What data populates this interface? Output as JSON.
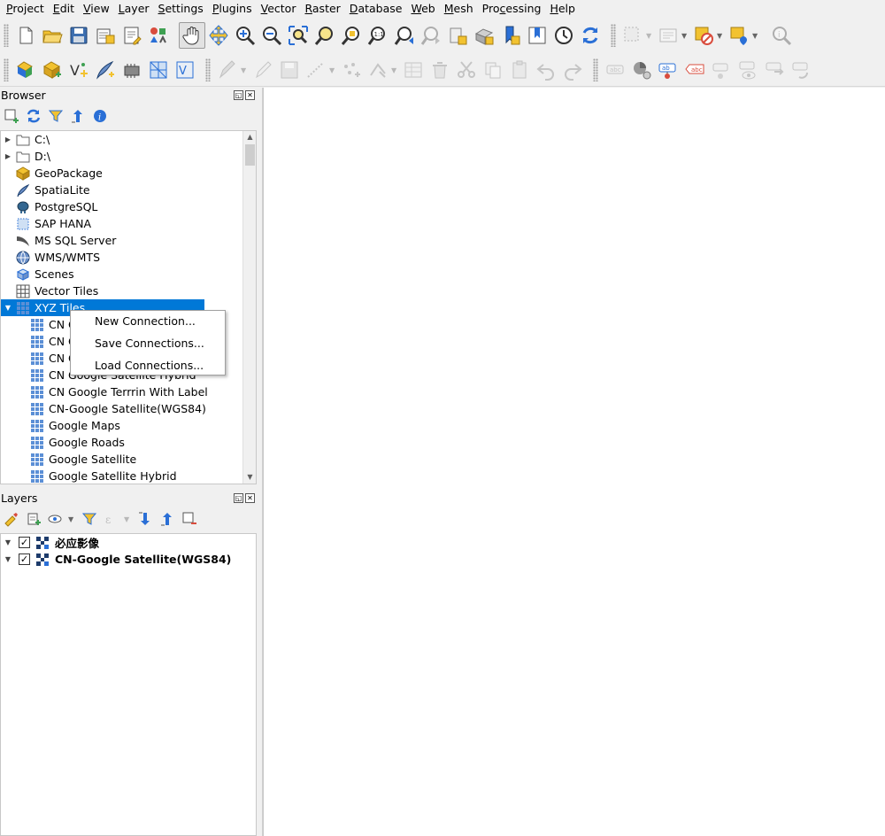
{
  "menubar": {
    "items": [
      {
        "acc": "P",
        "rest": "roject"
      },
      {
        "acc": "E",
        "rest": "dit"
      },
      {
        "acc": "V",
        "rest": "iew"
      },
      {
        "acc": "L",
        "rest": "ayer"
      },
      {
        "acc": "S",
        "rest": "ettings"
      },
      {
        "acc": "P",
        "rest": "lugins"
      },
      {
        "acc": "V",
        "rest": "ector"
      },
      {
        "acc": "R",
        "rest": "aster"
      },
      {
        "acc": "D",
        "rest": "atabase"
      },
      {
        "acc": "W",
        "rest": "eb"
      },
      {
        "acc": "M",
        "rest": "esh"
      },
      {
        "acc": "",
        "rest": "Processing",
        "pre": "Pro",
        "accmid": "c",
        "post": "essing"
      },
      {
        "acc": "H",
        "rest": "elp"
      }
    ]
  },
  "browser": {
    "title": "Browser",
    "items": [
      {
        "label": "C:\\",
        "icon": "folder-icon"
      },
      {
        "label": "D:\\",
        "icon": "folder-icon"
      },
      {
        "label": "GeoPackage",
        "icon": "geopackage-icon"
      },
      {
        "label": "SpatiaLite",
        "icon": "spatialite-icon"
      },
      {
        "label": "PostgreSQL",
        "icon": "postgresql-icon"
      },
      {
        "label": "SAP HANA",
        "icon": "sap-hana-icon"
      },
      {
        "label": "MS SQL Server",
        "icon": "mssql-icon"
      },
      {
        "label": "WMS/WMTS",
        "icon": "wms-icon"
      },
      {
        "label": "Scenes",
        "icon": "scenes-icon"
      },
      {
        "label": "Vector Tiles",
        "icon": "vector-tiles-icon"
      },
      {
        "label": "XYZ Tiles",
        "icon": "xyz-tiles-icon"
      }
    ],
    "xyz_children": [
      "CN G",
      "CN G",
      "CN G",
      "CN Google Satellite Hybrid",
      "CN Google Terrrin With Label",
      "CN-Google Satellite(WGS84)",
      "Google Maps",
      "Google Roads",
      "Google Satellite",
      "Google Satellite Hybrid"
    ]
  },
  "context_menu": {
    "items": [
      "New Connection...",
      "Save Connections...",
      "Load Connections..."
    ]
  },
  "layers": {
    "title": "Layers",
    "items": [
      {
        "name": "必应影像",
        "checked": "✓"
      },
      {
        "name": "CN-Google Satellite(WGS84)",
        "checked": "✓"
      }
    ]
  },
  "colors": {
    "selection": "#0078d7",
    "accent_yellow": "#f2c230",
    "accent_blue": "#2a6fd6"
  }
}
